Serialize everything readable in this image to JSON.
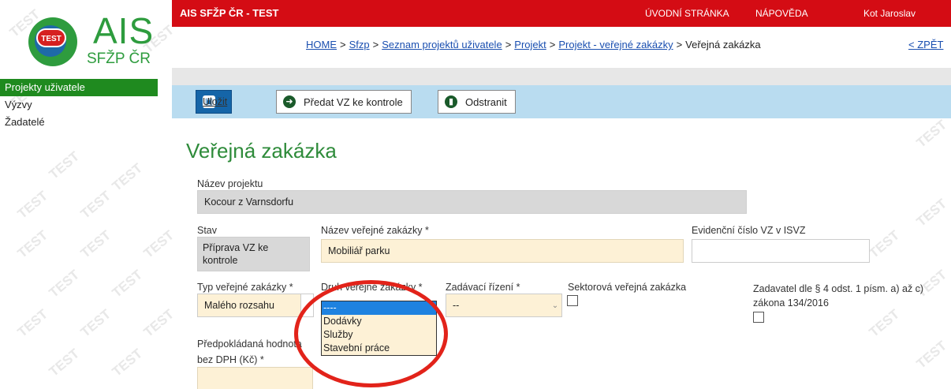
{
  "watermark": "TEST",
  "logo": {
    "badge": "TEST",
    "title": "AIS",
    "subtitle": "SFŽP ČR"
  },
  "leftnav": [
    {
      "label": "Projekty uživatele",
      "active": true
    },
    {
      "label": "Výzvy",
      "active": false
    },
    {
      "label": "Žadatelé",
      "active": false
    }
  ],
  "topbar": {
    "brand": "AIS SFŽP ČR - TEST",
    "home": "ÚVODNÍ STRÁNKA",
    "help": "NÁPOVĚDA",
    "user": "Kot Jaroslav"
  },
  "breadcrumb": {
    "items": [
      "HOME",
      "Sfzp",
      "Seznam projektů uživatele",
      "Projekt",
      "Projekt - veřejné zakázky"
    ],
    "current": "Veřejná zakázka",
    "separator": ">",
    "back": "< ZPĚT"
  },
  "toolbar": {
    "save": "Uložit",
    "submit": "Předat VZ ke kontrole",
    "delete": "Odstranit"
  },
  "page_title": "Veřejná zakázka",
  "form": {
    "project_name_label": "Název projektu",
    "project_name_value": "Kocour z Varnsdorfu",
    "status_label": "Stav",
    "status_value": "Příprava VZ ke kontrole",
    "contract_name_label": "Název veřejné zakázky *",
    "contract_name_value": "Mobiliář parku",
    "isvz_label": "Evidenční číslo VZ v ISVZ",
    "isvz_value": "",
    "type_label": "Typ veřejné zakázky *",
    "type_value": "Malého rozsahu",
    "kind_label": "Druh veřejné zakázky *",
    "kind_options": [
      "----",
      "Dodávky",
      "Služby",
      "Stavební práce"
    ],
    "procedure_label": "Zadávací řízení *",
    "procedure_value": "--",
    "sector_label": "Sektorová veřejná zakázka",
    "contracting_label": "Zadavatel dle § 4 odst. 1 písm. a) až c) zákona 134/2016",
    "estimated_label": "Předpokládaná hodnota bez DPH (Kč) *",
    "estimated_value": ""
  },
  "colors": {
    "topbar": "#d40c14",
    "accent_green": "#2e8b3a",
    "toolbar_bg": "#b9dcf0",
    "primary_button": "#1565a8",
    "highlight_circle": "#e2231a",
    "selected_option": "#1e82e0"
  }
}
